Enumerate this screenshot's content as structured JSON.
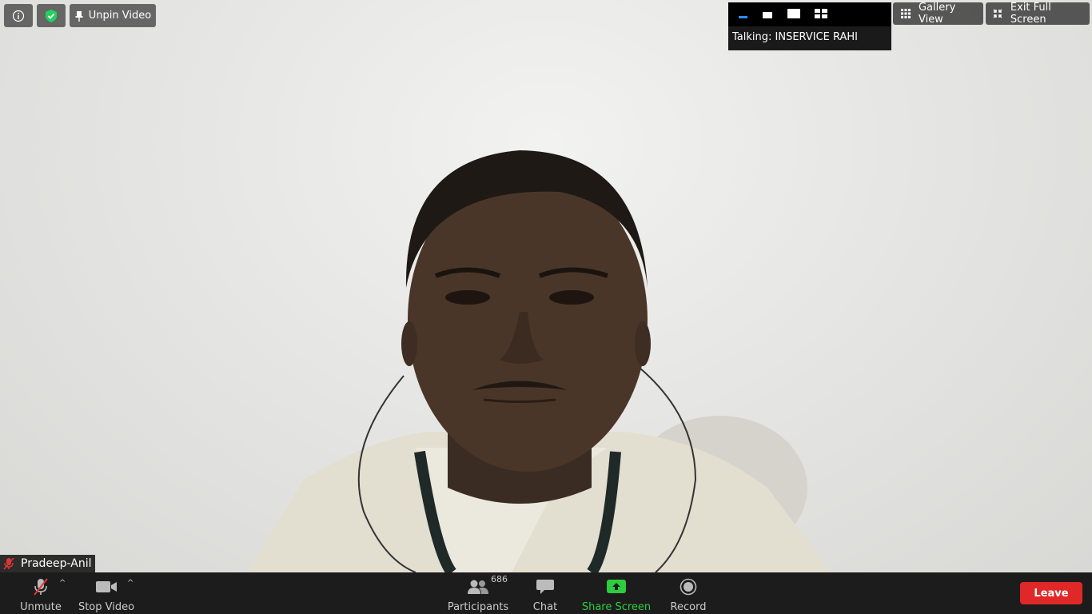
{
  "top_left": {
    "info_icon": "info-icon",
    "security_icon": "shield-check-icon",
    "unpin_label": "Unpin Video"
  },
  "view_panel": {
    "talking_text": "Talking: INSERVICE RAHI"
  },
  "top_right": {
    "gallery_label": "Gallery View",
    "exit_label": "Exit Full Screen"
  },
  "video": {
    "participant_name": "Pradeep-Anil"
  },
  "toolbar": {
    "unmute_label": "Unmute",
    "stop_video_label": "Stop Video",
    "participants_label": "Participants",
    "participants_count": "686",
    "chat_label": "Chat",
    "share_label": "Share Screen",
    "record_label": "Record",
    "leave_label": "Leave"
  },
  "colors": {
    "share_green": "#2ecc40",
    "leave_red": "#e02828",
    "muted_red": "#e03535",
    "accent_blue": "#2d8cff"
  }
}
